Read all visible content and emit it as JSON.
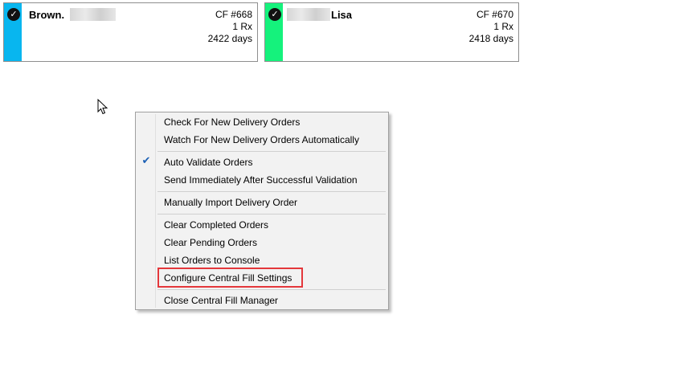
{
  "cards": [
    {
      "name": "Brown.",
      "cf": "CF #668",
      "rx": "1 Rx",
      "days": "2422 days",
      "stripe_color": "#08b6ef"
    },
    {
      "name": "Lisa",
      "cf": "CF #670",
      "rx": "1 Rx",
      "days": "2418 days",
      "stripe_color": "#15f27c"
    }
  ],
  "menu": {
    "items": [
      {
        "label": "Check For New Delivery Orders"
      },
      {
        "label": "Watch For New Delivery Orders Automatically"
      },
      {
        "label": "Auto Validate Orders",
        "checked": true
      },
      {
        "label": "Send Immediately After Successful Validation"
      },
      {
        "label": "Manually Import Delivery Order"
      },
      {
        "label": "Clear Completed Orders"
      },
      {
        "label": "Clear Pending Orders"
      },
      {
        "label": "List Orders to Console"
      },
      {
        "label": "Configure Central Fill Settings",
        "highlighted": true
      },
      {
        "label": "Close Central Fill Manager"
      }
    ]
  },
  "icons": {
    "check": "check-circle-icon",
    "checkmark": "checkmark-icon",
    "cursor": "mouse-pointer-icon"
  }
}
